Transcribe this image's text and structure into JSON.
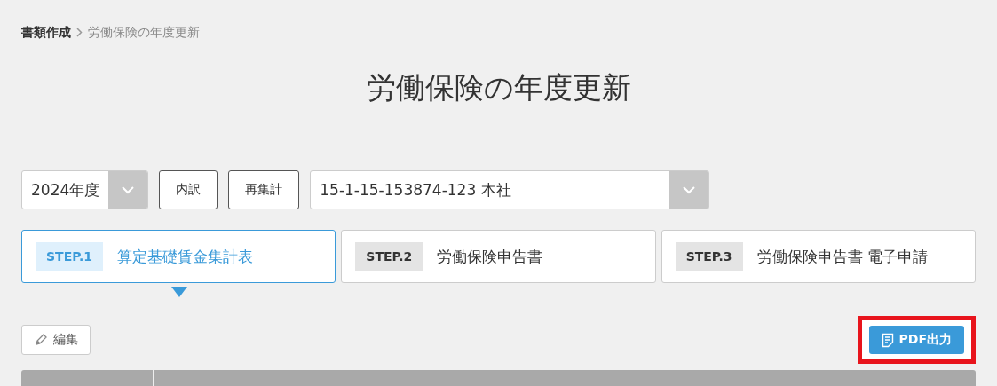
{
  "breadcrumb": [
    {
      "label": "書類作成",
      "current": false
    },
    {
      "label": "労働保険の年度更新",
      "current": true
    }
  ],
  "title": "労働保険の年度更新",
  "toolbar": {
    "year_select": {
      "value": "2024年度"
    },
    "buttons": [
      "内訳",
      "再集計"
    ],
    "office_select": {
      "value": "15-1-15-153874-123 本社"
    }
  },
  "steps": [
    {
      "badge": "STEP.1",
      "label": "算定基礎賃金集計表",
      "selected": true
    },
    {
      "badge": "STEP.2",
      "label": "労働保険申告書",
      "selected": false
    },
    {
      "badge": "STEP.3",
      "label": "労働保険申告書 電子申請",
      "selected": false
    }
  ],
  "edit_button": {
    "label": "編集"
  },
  "pdf_button": {
    "label": "PDF出力",
    "highlighted": true
  }
}
